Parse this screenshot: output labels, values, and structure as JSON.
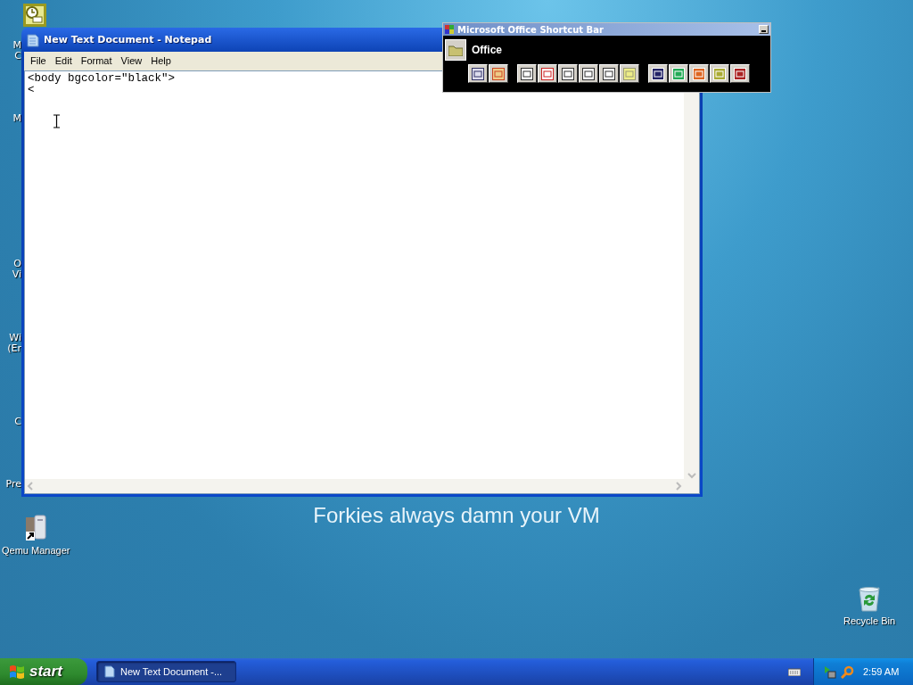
{
  "desktop": {
    "wallpaper_text": "Forkies always damn your VM",
    "covered_labels": [
      "M",
      "C",
      "M",
      "O",
      "Vi",
      "Wi",
      "(Er",
      "C",
      "Pre"
    ],
    "icons": [
      {
        "kind": "calendar"
      },
      {
        "kind": "qemu",
        "label": "Qemu Manager"
      },
      {
        "kind": "recycle",
        "label": "Recycle Bin"
      }
    ]
  },
  "notepad": {
    "title": "New Text Document - Notepad",
    "menu": [
      "File",
      "Edit",
      "Format",
      "View",
      "Help"
    ],
    "lines": [
      "<body bgcolor=\"black\">",
      "<"
    ]
  },
  "office_bar": {
    "title": "Microsoft Office Shortcut Bar",
    "folder": "Office"
  },
  "taskbar": {
    "start": "start",
    "tasks": [
      {
        "label": "New Text Document -...",
        "selected": true
      }
    ],
    "clock": "2:59 AM"
  }
}
